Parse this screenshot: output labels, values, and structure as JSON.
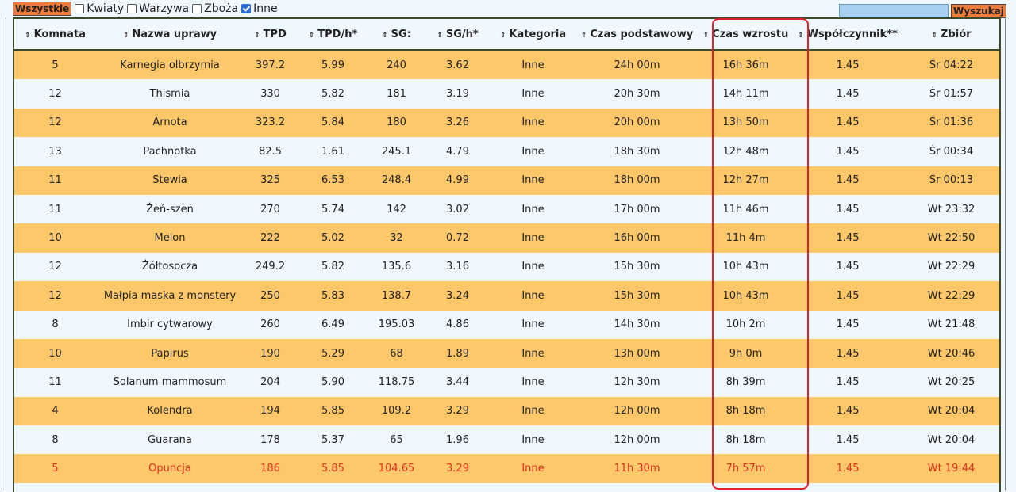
{
  "toolbar": {
    "all_label": "Wszystkie",
    "filters": [
      {
        "label": "Kwiaty",
        "checked": false
      },
      {
        "label": "Warzywa",
        "checked": false
      },
      {
        "label": "Zboża",
        "checked": false
      },
      {
        "label": "Inne",
        "checked": true
      }
    ],
    "search_value": "",
    "search_label": "Wyszukaj"
  },
  "table": {
    "headers": [
      "Komnata",
      "Nazwa uprawy",
      "TPD",
      "TPD/h*",
      "SG:",
      "SG/h*",
      "Kategoria",
      "Czas podstawowy",
      "Czas wzrostu",
      "Współczynnik**",
      "Zbiór"
    ],
    "rows": [
      [
        "5",
        "Karnegia olbrzymia",
        "397.2",
        "5.99",
        "240",
        "3.62",
        "Inne",
        "24h 00m",
        "16h 36m",
        "1.45",
        "Śr 04:22"
      ],
      [
        "12",
        "Thismia",
        "330",
        "5.82",
        "181",
        "3.19",
        "Inne",
        "20h 30m",
        "14h 11m",
        "1.45",
        "Śr 01:57"
      ],
      [
        "12",
        "Arnota",
        "323.2",
        "5.84",
        "180",
        "3.26",
        "Inne",
        "20h 00m",
        "13h 50m",
        "1.45",
        "Śr 01:36"
      ],
      [
        "13",
        "Pachnotka",
        "82.5",
        "1.61",
        "245.1",
        "4.79",
        "Inne",
        "18h 30m",
        "12h 48m",
        "1.45",
        "Śr 00:34"
      ],
      [
        "11",
        "Stewia",
        "325",
        "6.53",
        "248.4",
        "4.99",
        "Inne",
        "18h 00m",
        "12h 27m",
        "1.45",
        "Śr 00:13"
      ],
      [
        "11",
        "Żeń-szeń",
        "270",
        "5.74",
        "142",
        "3.02",
        "Inne",
        "17h 00m",
        "11h 46m",
        "1.45",
        "Wt 23:32"
      ],
      [
        "10",
        "Melon",
        "222",
        "5.02",
        "32",
        "0.72",
        "Inne",
        "16h 00m",
        "11h 4m",
        "1.45",
        "Wt 22:50"
      ],
      [
        "12",
        "Żółtosocza",
        "249.2",
        "5.82",
        "135.6",
        "3.16",
        "Inne",
        "15h 30m",
        "10h 43m",
        "1.45",
        "Wt 22:29"
      ],
      [
        "12",
        "Małpia maska z monstery",
        "250",
        "5.83",
        "138.7",
        "3.24",
        "Inne",
        "15h 30m",
        "10h 43m",
        "1.45",
        "Wt 22:29"
      ],
      [
        "8",
        "Imbir cytwarowy",
        "260",
        "6.49",
        "195.03",
        "4.86",
        "Inne",
        "14h 30m",
        "10h 2m",
        "1.45",
        "Wt 21:48"
      ],
      [
        "10",
        "Papirus",
        "190",
        "5.29",
        "68",
        "1.89",
        "Inne",
        "13h 00m",
        "9h 0m",
        "1.45",
        "Wt 20:46"
      ],
      [
        "11",
        "Solanum mammosum",
        "204",
        "5.90",
        "118.75",
        "3.44",
        "Inne",
        "12h 30m",
        "8h 39m",
        "1.45",
        "Wt 20:25"
      ],
      [
        "4",
        "Kolendra",
        "194",
        "5.85",
        "109.2",
        "3.29",
        "Inne",
        "12h 00m",
        "8h 18m",
        "1.45",
        "Wt 20:04"
      ],
      [
        "8",
        "Guarana",
        "178",
        "5.37",
        "65",
        "1.96",
        "Inne",
        "12h 00m",
        "8h 18m",
        "1.45",
        "Wt 20:04"
      ],
      [
        "5",
        "Opuncja",
        "186",
        "5.85",
        "104.65",
        "3.29",
        "Inne",
        "11h 30m",
        "7h 57m",
        "1.45",
        "Wt 19:44"
      ]
    ],
    "highlighted_row_index": 14
  },
  "colors": {
    "row_odd": "#fdc76a",
    "row_even": "#f0f8ff",
    "button": "#f07c3c",
    "highlight_text": "#e0301e",
    "annotation_box": "#e0202a"
  }
}
